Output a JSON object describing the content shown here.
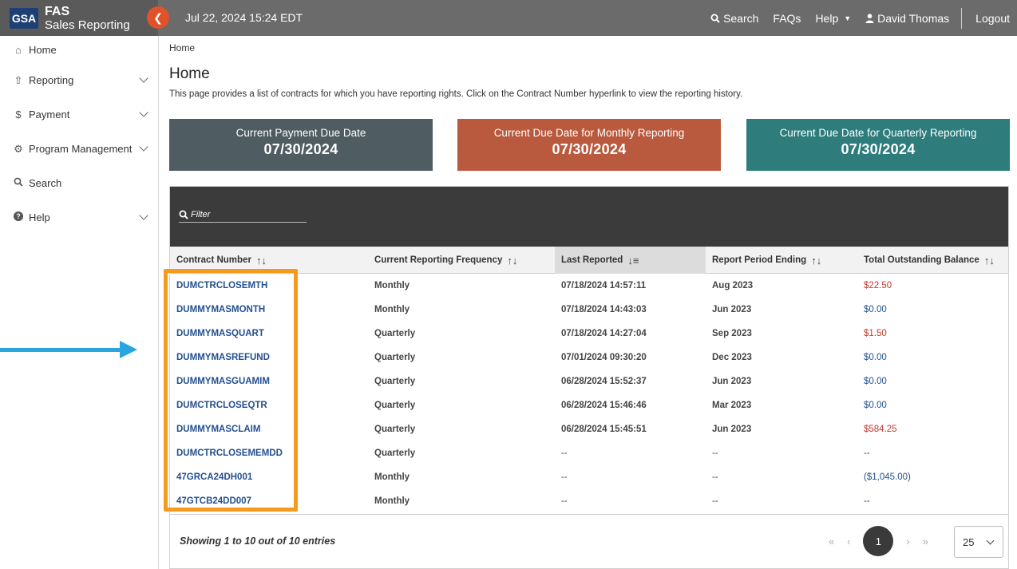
{
  "app": {
    "logo_badge": "GSA",
    "logo_title": "FAS",
    "logo_subtitle": "Sales Reporting",
    "datetime": "Jul 22, 2024 15:24 EDT"
  },
  "topnav": {
    "search": "Search",
    "faqs": "FAQs",
    "help": "Help",
    "user": "David Thomas",
    "logout": "Logout"
  },
  "sidebar": {
    "items": [
      {
        "label": "Home",
        "icon": "home-icon"
      },
      {
        "label": "Reporting",
        "icon": "upload-icon"
      },
      {
        "label": "Payment",
        "icon": "dollar-icon"
      },
      {
        "label": "Program Management",
        "icon": "gear-icon"
      },
      {
        "label": "Search",
        "icon": "search-icon"
      },
      {
        "label": "Help",
        "icon": "question-icon"
      }
    ]
  },
  "breadcrumb": "Home",
  "page": {
    "title": "Home",
    "description": "This page provides a list of contracts for which you have reporting rights. Click on the Contract Number hyperlink to view the reporting history."
  },
  "cards": [
    {
      "title": "Current Payment Due Date",
      "value": "07/30/2024",
      "color": "#4f5d63"
    },
    {
      "title": "Current Due Date for Monthly Reporting",
      "value": "07/30/2024",
      "color": "#b95a3e"
    },
    {
      "title": "Current Due Date for Quarterly Reporting",
      "value": "07/30/2024",
      "color": "#2e7c7c"
    }
  ],
  "filter": {
    "placeholder": "Filter"
  },
  "table": {
    "headers": [
      "Contract Number",
      "Current Reporting Frequency",
      "Last Reported",
      "Report Period Ending",
      "Total Outstanding Balance"
    ],
    "rows": [
      [
        "DUMCTRCLOSEMTH",
        "Monthly",
        "07/18/2024  14:57:11",
        "Aug 2023",
        "$22.50"
      ],
      [
        "DUMMYMASMONTH",
        "Monthly",
        "07/18/2024  14:43:03",
        "Jun 2023",
        "$0.00"
      ],
      [
        "DUMMYMASQUART",
        "Quarterly",
        "07/18/2024  14:27:04",
        "Sep 2023",
        "$1.50"
      ],
      [
        "DUMMYMASREFUND",
        "Quarterly",
        "07/01/2024  09:30:20",
        "Dec 2023",
        "$0.00"
      ],
      [
        "DUMMYMASGUAMIM",
        "Quarterly",
        "06/28/2024  15:52:37",
        "Jun 2023",
        "$0.00"
      ],
      [
        "DUMCTRCLOSEQTR",
        "Quarterly",
        "06/28/2024  15:46:46",
        "Mar 2023",
        "$0.00"
      ],
      [
        "DUMMYMASCLAIM",
        "Quarterly",
        "06/28/2024  15:45:51",
        "Jun 2023",
        "$584.25"
      ],
      [
        "DUMCTRCLOSEMEMDD",
        "Quarterly",
        "--",
        "--",
        "--"
      ],
      [
        "47GRCA24DH001",
        "Monthly",
        "--",
        "--",
        "($1,045.00)"
      ],
      [
        "47GTCB24DD007",
        "Monthly",
        "--",
        "--",
        "--"
      ]
    ],
    "balance_colors": [
      "red",
      "blue",
      "red",
      "blue",
      "blue",
      "blue",
      "red",
      "dash",
      "blue",
      "dash"
    ]
  },
  "footer": {
    "showing": "Showing 1 to 10 out of 10 entries",
    "pager": {
      "first": "«",
      "prev": "‹",
      "current": "1",
      "next": "›",
      "last": "»"
    },
    "page_size": "25"
  },
  "colors": {
    "accent_orange": "#e0522a",
    "highlight_box": "#f59a1c",
    "arrow": "#29a6df",
    "link": "#23508f",
    "negative": "#c0392b"
  }
}
